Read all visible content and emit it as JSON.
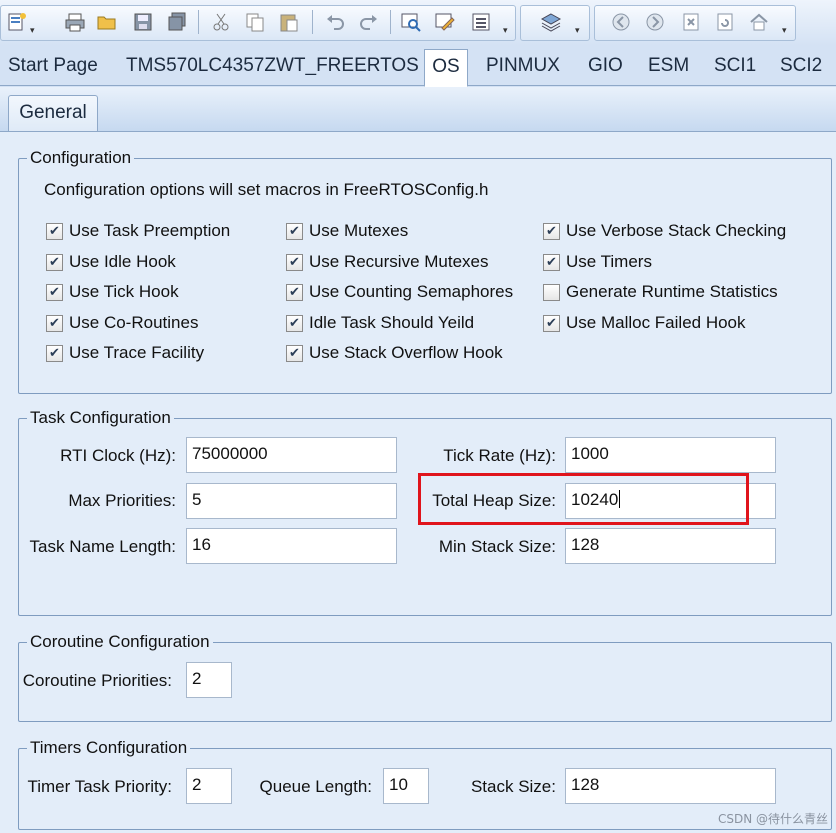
{
  "toolbar": {
    "icons": [
      "new-file-icon",
      "print-icon",
      "open-folder-icon",
      "save-icon",
      "save-all-icon",
      "cut-icon",
      "copy-icon",
      "paste-icon",
      "undo-icon",
      "redo-icon",
      "find-icon",
      "edit-icon",
      "list-icon",
      "layers-icon",
      "back-icon",
      "forward-icon",
      "close-icon",
      "refresh-icon",
      "home-icon"
    ]
  },
  "tabs": [
    "Start Page",
    "TMS570LC4357ZWT_FREERTOS",
    "OS",
    "PINMUX",
    "GIO",
    "ESM",
    "SCI1",
    "SCI2"
  ],
  "active_tab": "OS",
  "subtab": "General",
  "configuration": {
    "legend": "Configuration",
    "description": "Configuration options will set macros in FreeRTOSConfig.h",
    "options": [
      {
        "label": "Use Task Preemption",
        "checked": true
      },
      {
        "label": "Use Idle Hook",
        "checked": true
      },
      {
        "label": "Use Tick Hook",
        "checked": true
      },
      {
        "label": "Use Co-Routines",
        "checked": true
      },
      {
        "label": "Use Trace Facility",
        "checked": true
      },
      {
        "label": "Use Mutexes",
        "checked": true
      },
      {
        "label": "Use Recursive Mutexes",
        "checked": true
      },
      {
        "label": "Use Counting Semaphores",
        "checked": true
      },
      {
        "label": "Idle Task Should Yeild",
        "checked": true
      },
      {
        "label": "Use Stack Overflow Hook",
        "checked": true
      },
      {
        "label": "Use Verbose Stack Checking",
        "checked": true
      },
      {
        "label": "Use Timers",
        "checked": true
      },
      {
        "label": "Generate Runtime Statistics",
        "checked": false
      },
      {
        "label": "Use Malloc Failed Hook",
        "checked": true
      }
    ]
  },
  "task_configuration": {
    "legend": "Task Configuration",
    "rti_clock_label": "RTI Clock (Hz):",
    "rti_clock_value": "75000000",
    "max_priorities_label": "Max Priorities:",
    "max_priorities_value": "5",
    "task_name_length_label": "Task Name Length:",
    "task_name_length_value": "16",
    "tick_rate_label": "Tick Rate (Hz):",
    "tick_rate_value": "1000",
    "total_heap_label": "Total Heap Size:",
    "total_heap_value": "10240",
    "min_stack_label": "Min Stack Size:",
    "min_stack_value": "128"
  },
  "coroutine_configuration": {
    "legend": "Coroutine Configuration",
    "priorities_label": "Coroutine Priorities:",
    "priorities_value": "2"
  },
  "timers_configuration": {
    "legend": "Timers Configuration",
    "priority_label": "Timer Task Priority:",
    "priority_value": "2",
    "queue_label": "Queue Length:",
    "queue_value": "10",
    "stack_label": "Stack Size:",
    "stack_value": "128"
  },
  "watermark": "CSDN @待什么青丝",
  "colors": {
    "highlight": "#e0141c",
    "background": "#e3edf9"
  }
}
